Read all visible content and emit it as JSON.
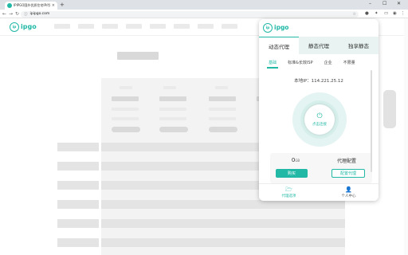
{
  "browser": {
    "tab_title": "IPIPGO国外优质住宅IP代理…",
    "tab_close": "×",
    "new_tab": "+",
    "minimize": "–",
    "maximize": "☐",
    "close": "✕",
    "back": "←",
    "forward": "→",
    "reload": "↻",
    "url": "ipipgo.com"
  },
  "site": {
    "logo_badge": "ip",
    "logo_text": "ipgo"
  },
  "popup": {
    "logo_badge": "ip",
    "logo_text": "ipgo",
    "main_tabs": [
      {
        "label": "动态代理",
        "active": true
      },
      {
        "label": "静态代理",
        "active": false
      },
      {
        "label": "独享静态",
        "active": false
      }
    ],
    "sub_tabs": [
      {
        "label": "基础",
        "active": true
      },
      {
        "label": "标准&长效ISP",
        "active": false
      },
      {
        "label": "企业",
        "active": false
      },
      {
        "label": "不限量",
        "active": false
      }
    ],
    "ip_line": "本地IP：114.221.25.12",
    "connect_label": "点击连接",
    "traffic_value": "0",
    "traffic_unit": "GB",
    "buy_label": "购买",
    "config_title": "代理配置",
    "config_button": "配置代理",
    "bottom_nav": [
      {
        "label": "代理选项",
        "icon": "folder-icon",
        "active": true
      },
      {
        "label": "个人中心",
        "icon": "user-icon",
        "active": false
      }
    ]
  },
  "colors": {
    "accent": "#21b8a6"
  }
}
